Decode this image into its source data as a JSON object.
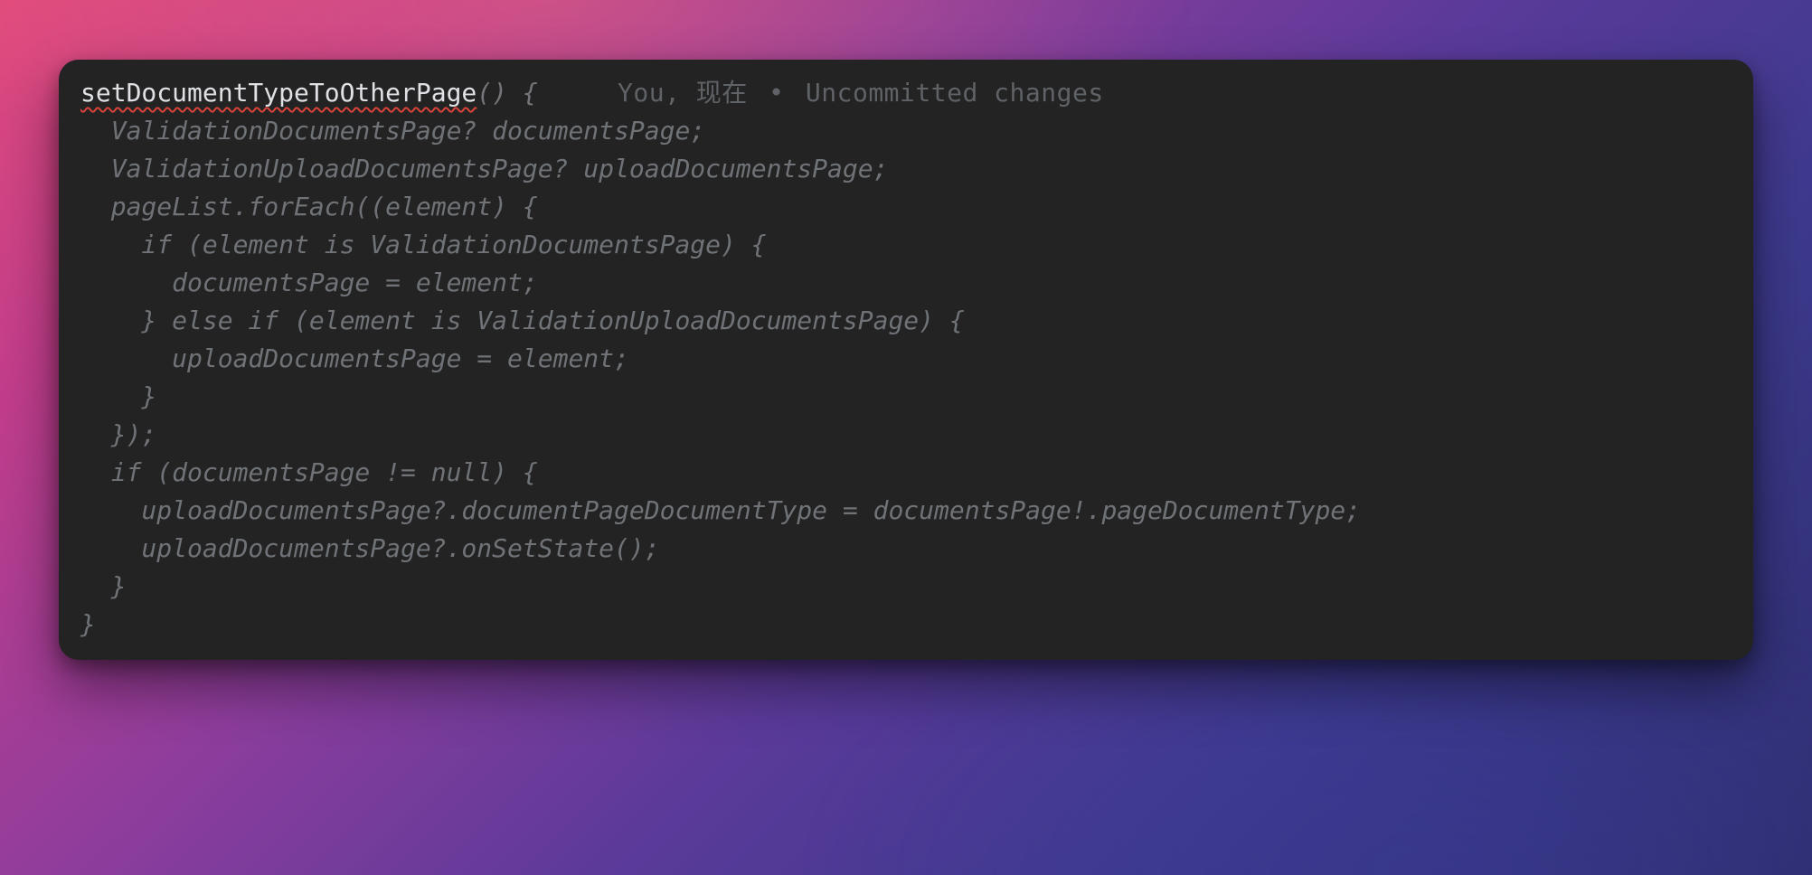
{
  "codelens": {
    "author": "You,",
    "time": "现在",
    "separator": "•",
    "status": "Uncommitted changes"
  },
  "code": {
    "fn_name": "setDocumentTypeToOtherPage",
    "fn_suffix": "() {",
    "body": "  ValidationDocumentsPage? documentsPage;\n  ValidationUploadDocumentsPage? uploadDocumentsPage;\n  pageList.forEach((element) {\n    if (element is ValidationDocumentsPage) {\n      documentsPage = element;\n    } else if (element is ValidationUploadDocumentsPage) {\n      uploadDocumentsPage = element;\n    }\n  });\n  if (documentsPage != null) {\n    uploadDocumentsPage?.documentPageDocumentType = documentsPage!.pageDocumentType;\n    uploadDocumentsPage?.onSetState();\n  }\n}"
  }
}
